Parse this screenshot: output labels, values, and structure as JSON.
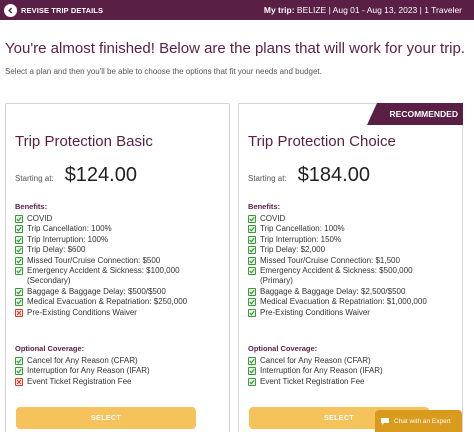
{
  "topbar": {
    "back_label": "REVISE TRIP DETAILS",
    "trip_lead": "My trip:",
    "trip_details": " BELIZE | Aug 01 - Aug 13, 2023 | 1 Traveler"
  },
  "headline": "You're almost finished! Below are the plans that will work for your trip.",
  "subline": "Select a plan and then you'll be able to choose the options that fit your needs and budget.",
  "plans": [
    {
      "title": "Trip Protection Basic",
      "price_label": "Starting at:",
      "price": "$124.00",
      "benefits_title": "Benefits:",
      "benefits": [
        {
          "text": "COVID",
          "included": true
        },
        {
          "text": "Trip Cancellation: 100%",
          "included": true
        },
        {
          "text": "Trip Interruption: 100%",
          "included": true
        },
        {
          "text": "Trip Delay: $600",
          "included": true
        },
        {
          "text": "Missed Tour/Cruise Connection: $500",
          "included": true
        },
        {
          "text": "Emergency Accident & Sickness: $100,000",
          "included": true
        },
        {
          "text": "(Secondary)",
          "included": null
        },
        {
          "text": "Baggage & Baggage Delay: $500/$500",
          "included": true
        },
        {
          "text": "Medical Evacuation & Repatriation: $250,000",
          "included": true
        },
        {
          "text": "Pre-Existing Conditions Waiver",
          "included": false
        }
      ],
      "coverage_title": "Optional Coverage:",
      "coverage": [
        {
          "text": "Cancel for Any Reason (CFAR)",
          "included": true
        },
        {
          "text": "Interruption for Any Reason (IFAR)",
          "included": true
        },
        {
          "text": "Event Ticket Registration Fee",
          "included": false
        }
      ],
      "select_label": "SELECT"
    },
    {
      "title": "Trip Protection Choice",
      "badge": "RECOMMENDED",
      "price_label": "Starting at:",
      "price": "$184.00",
      "benefits_title": "Benefits:",
      "benefits": [
        {
          "text": "COVID",
          "included": true
        },
        {
          "text": "Trip Cancellation: 100%",
          "included": true
        },
        {
          "text": "Trip Interruption: 150%",
          "included": true
        },
        {
          "text": "Trip Delay: $2,000",
          "included": true
        },
        {
          "text": "Missed Tour/Cruise Connection: $1,500",
          "included": true
        },
        {
          "text": "Emergency Accident & Sickness: $500,000",
          "included": true
        },
        {
          "text": "(Primary)",
          "included": null
        },
        {
          "text": "Baggage & Baggage Delay: $2,500/$500",
          "included": true
        },
        {
          "text": "Medical Evacuation & Repatriation: $1,000,000",
          "included": true
        },
        {
          "text": "Pre-Existing Conditions Waiver",
          "included": true
        }
      ],
      "coverage_title": "Optional Coverage:",
      "coverage": [
        {
          "text": "Cancel for Any Reason (CFAR)",
          "included": true
        },
        {
          "text": "Interruption for Any Reason (IFAR)",
          "included": true
        },
        {
          "text": "Event Ticket Registration Fee",
          "included": true
        }
      ],
      "select_label": "SELECT"
    }
  ],
  "chat": {
    "label": "Chat with an Expert"
  },
  "colors": {
    "brand": "#5a1f45",
    "select": "#f6c25b",
    "chat": "#d89b1d",
    "check": "#3a9a3a",
    "cross": "#d0422b"
  },
  "icons": {
    "back": "chevron-left-icon",
    "included": "checkbox-checked-icon",
    "excluded": "checkbox-x-icon",
    "chat": "chat-bubble-icon"
  }
}
